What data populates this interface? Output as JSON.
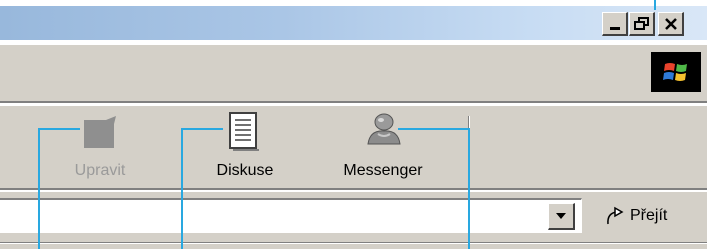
{
  "window": {
    "controls": {
      "minimize": "_",
      "restore": "🗗",
      "close": "✕"
    }
  },
  "menubar": {
    "logo_icon": "windows-flag-icon"
  },
  "toolbar": {
    "edit": {
      "label": "Upravit",
      "icon": "edit-icon",
      "enabled": false
    },
    "discuss": {
      "label": "Diskuse",
      "icon": "document-icon"
    },
    "messenger": {
      "label": "Messenger",
      "icon": "messenger-user-icon"
    }
  },
  "address": {
    "value": "",
    "dropdown_icon": "chevron-down-icon",
    "go_label": "Přejít",
    "go_icon": "go-arrow-icon"
  },
  "colors": {
    "callout": "#29a8e0",
    "titlebar": "#a8c4e4",
    "face": "#d4d0c8"
  }
}
